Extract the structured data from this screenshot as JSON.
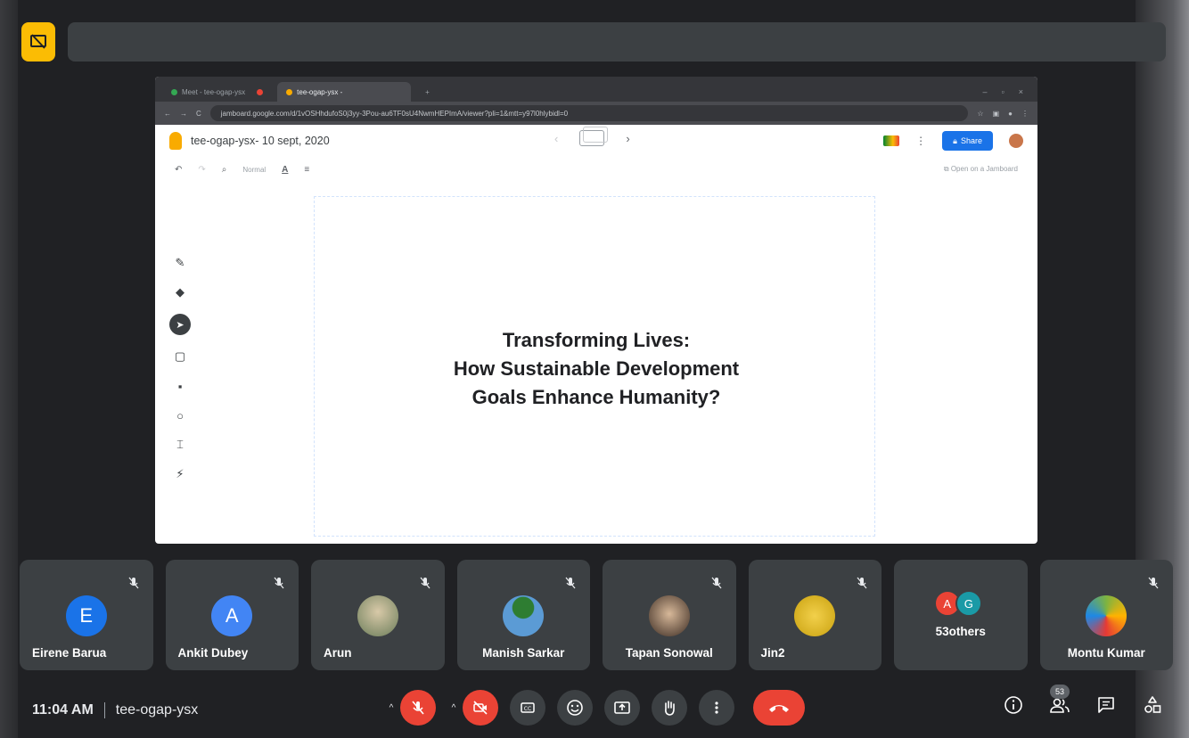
{
  "browser": {
    "tabs": [
      {
        "label": "Meet - tee-ogap-ysx"
      },
      {
        "label": "tee-ogap-ysx -"
      }
    ],
    "url": "jamboard.google.com/d/1vOSHhdufoS0j3yy-3Pou-au6TF0sU4NwmHEPImA/viewer?pli=1&mtt=y97l0hlybidl=0"
  },
  "jamboard": {
    "title": "tee-ogap-ysx- 10 sept, 2020",
    "share_label": "Share",
    "font_style": "Normal",
    "open_link": "Open on a Jamboard",
    "canvas_lines": [
      "Transforming Lives:",
      "How Sustainable Development",
      "Goals Enhance Humanity?"
    ]
  },
  "participants": [
    {
      "name": "Eirene Barua",
      "initial": "E",
      "color": "#1a73e8"
    },
    {
      "name": "Ankit Dubey",
      "initial": "A",
      "color": "#4285f4"
    },
    {
      "name": "Arun",
      "initial": "",
      "color": "#8e8a7a"
    },
    {
      "name": "Manish Sarkar",
      "initial": "",
      "color": "#5b9bd5"
    },
    {
      "name": "Tapan Sonowal",
      "initial": "",
      "color": "#a07855"
    },
    {
      "name": "Jin2",
      "initial": "",
      "color": "#e6c229"
    },
    {
      "name": "53others",
      "initials": [
        "A",
        "G"
      ],
      "colors": [
        "#ea4335",
        "#1a9aa6"
      ]
    },
    {
      "name": "Montu Kumar",
      "initial": "",
      "color": "#7cb342"
    }
  ],
  "meeting": {
    "time": "11:04 AM",
    "code": "tee-ogap-ysx",
    "people_count": "53"
  }
}
